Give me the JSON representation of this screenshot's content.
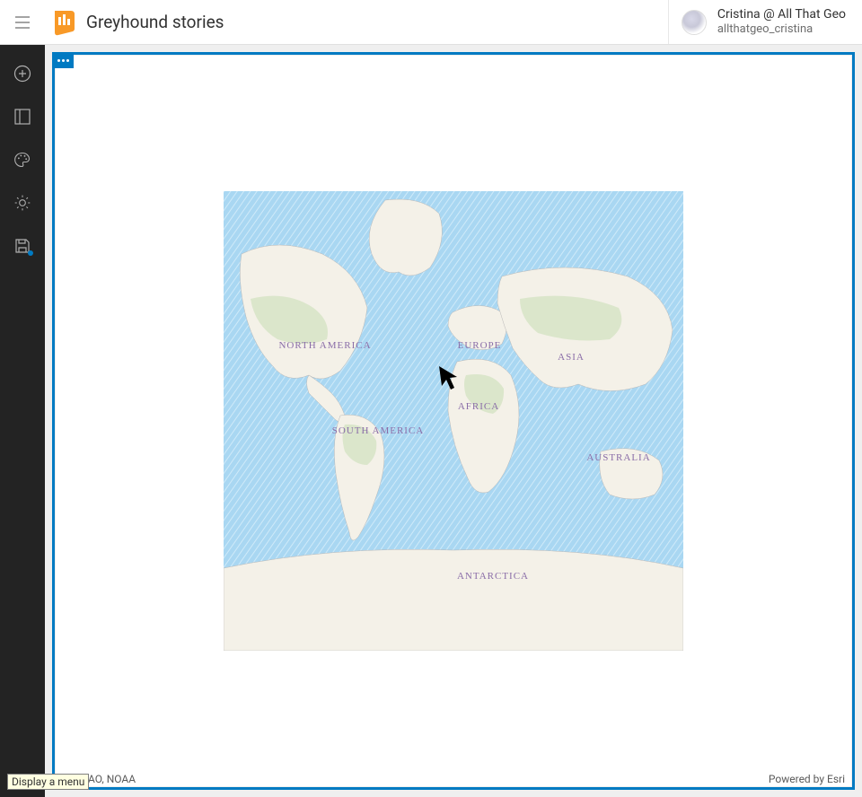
{
  "header": {
    "title": "Greyhound stories",
    "user_name": "Cristina @ All That Geo",
    "user_handle": "allthatgeo_cristina"
  },
  "sidebar": {
    "expand_label": "Expand"
  },
  "canvas": {
    "element_menu_label": "Element options"
  },
  "map": {
    "continents": {
      "north_america": "NORTH AMERICA",
      "south_america": "SOUTH AMERICA",
      "europe": "EUROPE",
      "africa": "AFRICA",
      "asia": "ASIA",
      "australia": "AUSTRALIA",
      "antarctica": "ANTARCTICA"
    },
    "attrib_left": "Esri, FAO, NOAA",
    "attrib_right": "Powered by Esri"
  },
  "tooltip": "Display a menu"
}
